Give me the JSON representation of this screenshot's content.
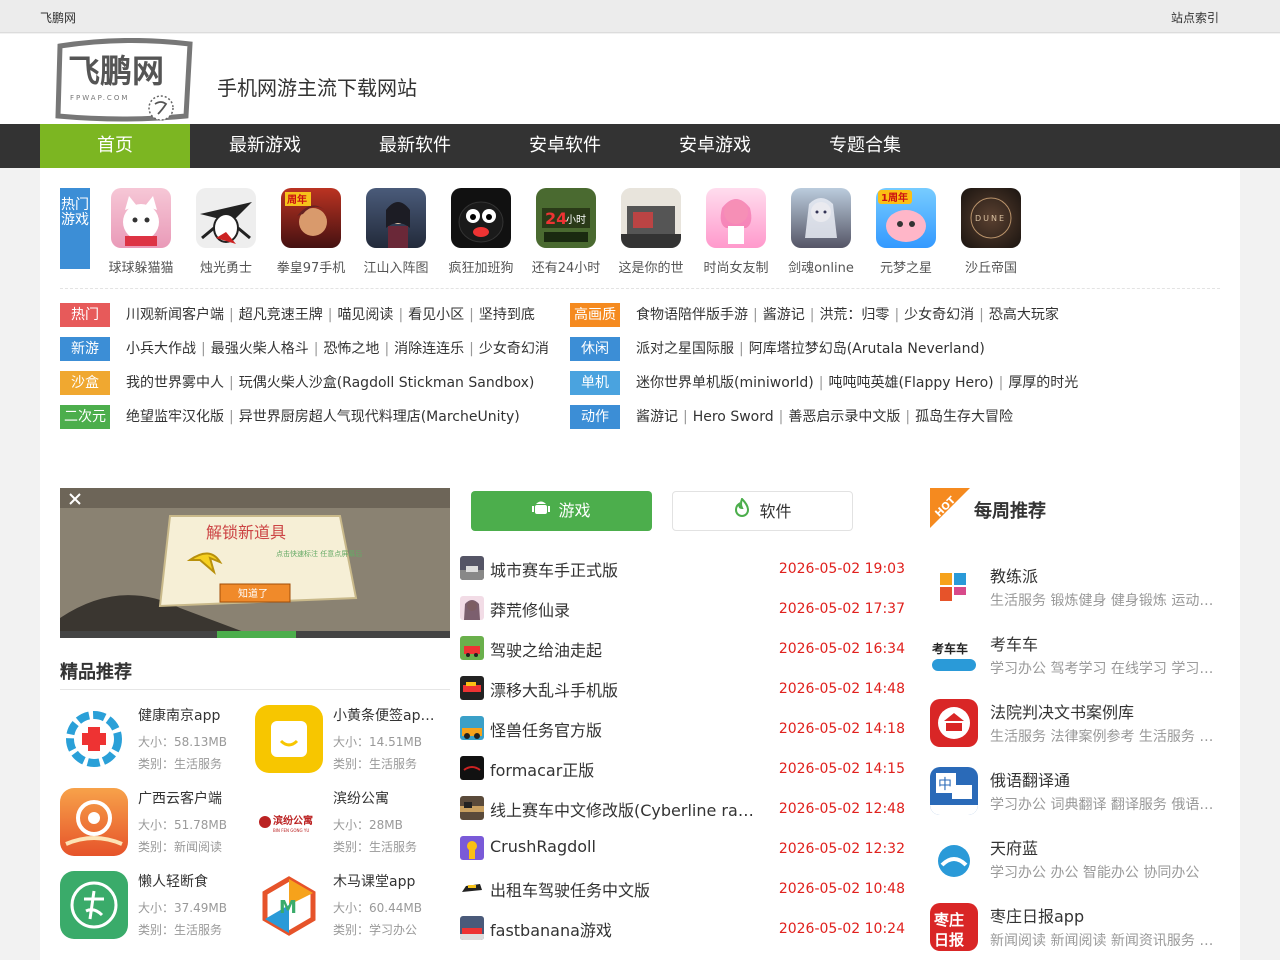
{
  "topbar": {
    "site_name": "飞鹏网",
    "site_index": "站点索引"
  },
  "header": {
    "logo_text": "飞鹏网",
    "logo_sub": "FPWAP.COM",
    "slogan": "手机网游主流下载网站"
  },
  "nav": {
    "items": [
      "首页",
      "最新游戏",
      "最新软件",
      "安卓软件",
      "安卓游戏",
      "专题合集"
    ],
    "active_color": "#7cb622"
  },
  "hot": {
    "label": "热门游戏",
    "games": [
      "球球躲猫猫",
      "烛光勇士",
      "拳皇97手机",
      "江山入阵图",
      "疯狂加班狗",
      "还有24小时",
      "这是你的世",
      "时尚女友制",
      "剑魂online",
      "元梦之星",
      "沙丘帝国"
    ]
  },
  "categories": {
    "left": [
      {
        "tag": "热门",
        "color": "#e75a5a",
        "links": [
          "川观新闻客户端",
          "超凡竞速王牌",
          "喵见阅读",
          "看见小区",
          "坚持到底"
        ]
      },
      {
        "tag": "新游",
        "color": "#3c8ed6",
        "links": [
          "小兵大作战",
          "最强火柴人格斗",
          "恐怖之地",
          "消除连连乐",
          "少女奇幻消"
        ]
      },
      {
        "tag": "沙盒",
        "color": "#f0a830",
        "links": [
          "我的世界雾中人",
          "玩偶火柴人沙盒(Ragdoll Stickman Sandbox)"
        ]
      },
      {
        "tag": "二次元",
        "color": "#4cae4c",
        "links": [
          "绝望监牢汉化版",
          "异世界厨房超人气现代料理店(MarcheUnity)"
        ]
      }
    ],
    "right": [
      {
        "tag": "高画质",
        "color": "#f58a1f",
        "links": [
          "食物语陪伴版手游",
          "酱游记",
          "洪荒：归零",
          "少女奇幻消",
          "恐高大玩家"
        ]
      },
      {
        "tag": "休闲",
        "color": "#3c8ed6",
        "links": [
          "派对之星国际服",
          "阿库塔拉梦幻岛(Arutala Neverland)"
        ]
      },
      {
        "tag": "单机",
        "color": "#4aa3df",
        "links": [
          "迷你世界单机版(miniworld)",
          "吨吨吨英雄(Flappy Hero)",
          "厚厚的时光"
        ]
      },
      {
        "tag": "动作",
        "color": "#3c8ed6",
        "links": [
          "酱游记",
          "Hero Sword",
          "善恶启示录中文版",
          "孤岛生存大冒险"
        ]
      }
    ]
  },
  "banner": {
    "title_text": "解锁新道具",
    "hint_text": "点击快速标注 任意点屏幕后",
    "button_text": "知道了"
  },
  "featured": {
    "title": "精品推荐",
    "apps": [
      {
        "name": "健康南京app",
        "size": "大小：58.13MB",
        "category": "类别：生活服务"
      },
      {
        "name": "小黄条便签app...",
        "size": "大小：14.51MB",
        "category": "类别：生活服务"
      },
      {
        "name": "广西云客户端",
        "size": "大小：51.78MB",
        "category": "类别：新闻阅读"
      },
      {
        "name": "滨纷公寓",
        "size": "大小：28MB",
        "category": "类别：生活服务"
      },
      {
        "name": "懒人轻断食",
        "size": "大小：37.49MB",
        "category": "类别：生活服务"
      },
      {
        "name": "木马课堂app",
        "size": "大小：60.44MB",
        "category": "类别：学习办公"
      }
    ]
  },
  "tabs": {
    "game": "游戏",
    "software": "软件"
  },
  "news": [
    {
      "title": "城市赛车手正式版",
      "date": "2026-05-02 19:03"
    },
    {
      "title": "莽荒修仙录",
      "date": "2026-05-02 17:37"
    },
    {
      "title": "驾驶之给油走起",
      "date": "2026-05-02 16:34"
    },
    {
      "title": "漂移大乱斗手机版",
      "date": "2026-05-02 14:48"
    },
    {
      "title": "怪兽任务官方版",
      "date": "2026-05-02 14:18"
    },
    {
      "title": "formacar正版",
      "date": "2026-05-02 14:15"
    },
    {
      "title": "线上赛车中文修改版(Cyberline racing)",
      "date": "2026-05-02 12:48"
    },
    {
      "title": "CrushRagdoll",
      "date": "2026-05-02 12:32"
    },
    {
      "title": "出租车驾驶任务中文版",
      "date": "2026-05-02 10:48"
    },
    {
      "title": "fastbanana游戏",
      "date": "2026-05-02 10:24"
    }
  ],
  "weekly": {
    "badge": "HOT",
    "title": "每周推荐",
    "items": [
      {
        "name": "教练派",
        "tags": "生活服务 锻炼健身 健身锻炼 运动健身"
      },
      {
        "name": "考车车",
        "tags": "学习办公 驾考学习 在线学习 学习平台"
      },
      {
        "name": "法院判决文书案例库",
        "tags": "生活服务 法律案例参考 生活服务 法律"
      },
      {
        "name": "俄语翻译通",
        "tags": "学习办公 词典翻译 翻译服务 俄语学习"
      },
      {
        "name": "天府蓝",
        "tags": "学习办公 办公 智能办公 协同办公"
      },
      {
        "name": "枣庄日报app",
        "tags": "新闻阅读 新闻阅读 新闻资讯服务 新闻"
      }
    ]
  }
}
